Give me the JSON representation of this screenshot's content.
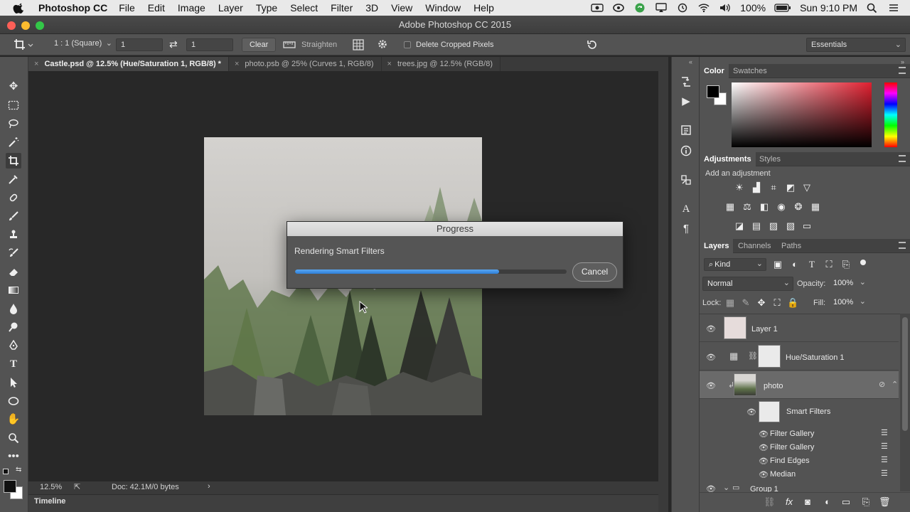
{
  "menubar": {
    "app_name": "Photoshop CC",
    "items": [
      "File",
      "Edit",
      "Image",
      "Layer",
      "Type",
      "Select",
      "Filter",
      "3D",
      "View",
      "Window",
      "Help"
    ],
    "battery": "100%",
    "clock": "Sun 9:10 PM"
  },
  "window": {
    "title": "Adobe Photoshop CC 2015"
  },
  "options": {
    "ratio": "1 : 1 (Square)",
    "width": "1",
    "height": "1",
    "clear_label": "Clear",
    "straighten_label": "Straighten",
    "delete_cropped_label": "Delete Cropped Pixels",
    "workspace": "Essentials"
  },
  "tabs": [
    {
      "label": "Castle.psd @ 12.5% (Hue/Saturation 1, RGB/8) *"
    },
    {
      "label": "photo.psb @ 25% (Curves 1, RGB/8)"
    },
    {
      "label": "trees.jpg @ 12.5% (RGB/8)"
    }
  ],
  "status": {
    "zoom": "12.5%",
    "doc": "Doc: 42.1M/0 bytes"
  },
  "timeline_label": "Timeline",
  "dialog": {
    "title": "Progress",
    "message": "Rendering Smart Filters",
    "progress": 0.75,
    "cancel_label": "Cancel"
  },
  "color_panel": {
    "tabs": [
      "Color",
      "Swatches"
    ]
  },
  "adjustments_panel": {
    "tabs": [
      "Adjustments",
      "Styles"
    ],
    "hint": "Add an adjustment"
  },
  "layers_panel": {
    "tabs": [
      "Layers",
      "Channels",
      "Paths"
    ],
    "filter_kind": "Kind",
    "blend_mode": "Normal",
    "opacity_label": "Opacity:",
    "opacity": "100%",
    "lock_label": "Lock:",
    "fill_label": "Fill:",
    "fill": "100%",
    "layers": [
      {
        "name": "Layer 1"
      },
      {
        "name": "Hue/Saturation 1"
      },
      {
        "name": "photo"
      }
    ],
    "smart_filters_label": "Smart Filters",
    "filters": [
      "Filter Gallery",
      "Filter Gallery",
      "Find Edges",
      "Median"
    ],
    "group_name": "Group 1"
  },
  "colors": {
    "progress_fill": "#3a8ee6",
    "panel_bg": "#535353",
    "canvas_bg": "#282828"
  }
}
